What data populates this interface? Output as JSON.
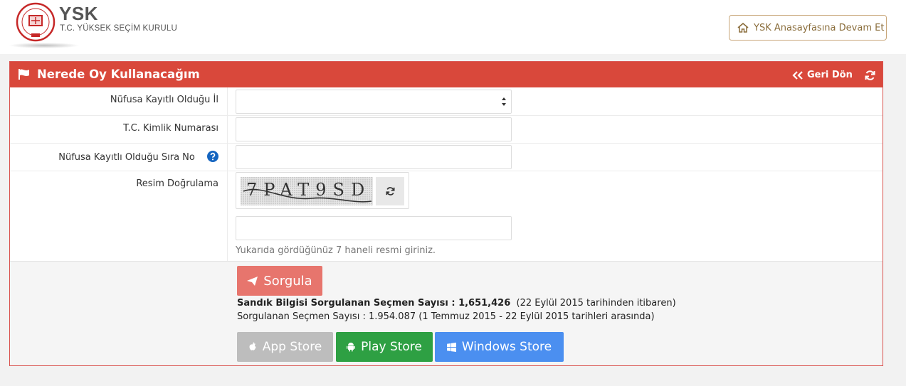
{
  "header": {
    "brand_main": "YSK",
    "brand_sub": "T.C. YÜKSEK SEÇİM KURULU",
    "home_button": "YSK Anasayfasına Devam Et"
  },
  "panel": {
    "title": "Nerede Oy Kullanacağım",
    "back_label": "Geri Dön"
  },
  "form": {
    "province_label": "Nüfusa Kayıtlı Olduğu İl",
    "province_value": "",
    "tc_label": "T.C. Kimlik Numarası",
    "tc_value": "",
    "sira_label": "Nüfusa Kayıtlı Olduğu Sıra No",
    "sira_value": "",
    "captcha_label": "Resim Doğrulama",
    "captcha_text": "7PAT9SD",
    "captcha_value": "",
    "captcha_hint": "Yukarıda gördüğünüz 7 haneli resmi giriniz."
  },
  "actions": {
    "submit_label": "Sorgula"
  },
  "stats": {
    "line1_bold": "Sandık Bilgisi Sorgulanan Seçmen Sayısı : 1,651,426",
    "line1_rest": "(22 Eylül 2015 tarihinden itibaren)",
    "line2": "Sorgulanan Seçmen Sayısı : 1.954.087  (1 Temmuz 2015 - 22 Eylül 2015 tarihleri arasında)"
  },
  "stores": {
    "app": "App Store",
    "play": "Play Store",
    "windows": "Windows Store"
  },
  "colors": {
    "panel_header": "#d9483b",
    "submit": "#e7756d",
    "app_store": "#bdbdbd",
    "play_store": "#2ea043",
    "windows_store": "#4b8ff0",
    "help": "#1565c0"
  },
  "icons": [
    "ysk-logo",
    "home-icon",
    "flag-icon",
    "chevrons-left-icon",
    "refresh-icon",
    "help-icon",
    "captcha-refresh-icon",
    "send-icon",
    "apple-icon",
    "android-icon",
    "windows-icon"
  ]
}
